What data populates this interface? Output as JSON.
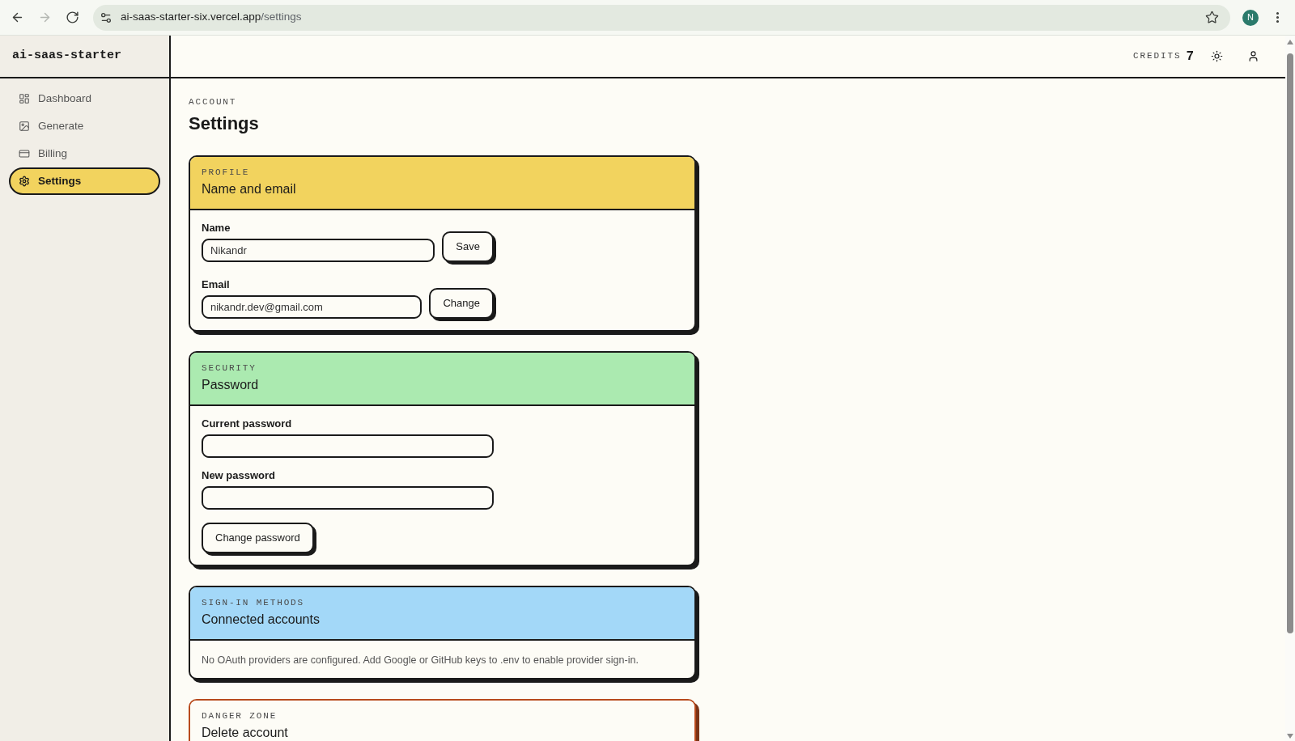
{
  "browser": {
    "nav": [
      {
        "kind": "back",
        "disabled": false
      },
      {
        "kind": "forward",
        "disabled": true
      },
      {
        "kind": "reload",
        "disabled": false
      }
    ],
    "url_host": "ai-saas-starter-six.vercel.app",
    "url_path": "/settings",
    "profile_initial": "N"
  },
  "sidebar": {
    "logo": "ai-saas-starter",
    "items": [
      {
        "label": "Dashboard",
        "selected": false
      },
      {
        "label": "Generate",
        "selected": false
      },
      {
        "label": "Billing",
        "selected": false
      },
      {
        "label": "Settings",
        "selected": true
      }
    ]
  },
  "header": {
    "credits_label": "CREDITS",
    "credits_value": "7"
  },
  "page": {
    "eyebrow": "ACCOUNT",
    "title": "Settings"
  },
  "sections": [
    {
      "kind": "inline_fields",
      "eyebrow": "PROFILE",
      "title": "Name and email",
      "color": "#f2d35e",
      "fields": [
        {
          "label": "Name",
          "value": "Nikandr",
          "button": "Save"
        },
        {
          "label": "Email",
          "value": "nikandr.dev@gmail.com",
          "button": "Change"
        }
      ]
    },
    {
      "kind": "stacked_fields",
      "eyebrow": "SECURITY",
      "title": "Password",
      "color": "#abeab0",
      "fields": [
        {
          "label": "Current password"
        },
        {
          "label": "New password"
        }
      ],
      "button": "Change password"
    },
    {
      "kind": "note",
      "eyebrow": "SIGN-IN METHODS",
      "title": "Connected accounts",
      "color": "#a3d8f8",
      "text": "No OAuth providers are configured. Add Google or GitHub keys to .env to enable provider sign-in."
    },
    {
      "kind": "danger",
      "eyebrow": "DANGER ZONE",
      "title": "Delete account"
    }
  ]
}
